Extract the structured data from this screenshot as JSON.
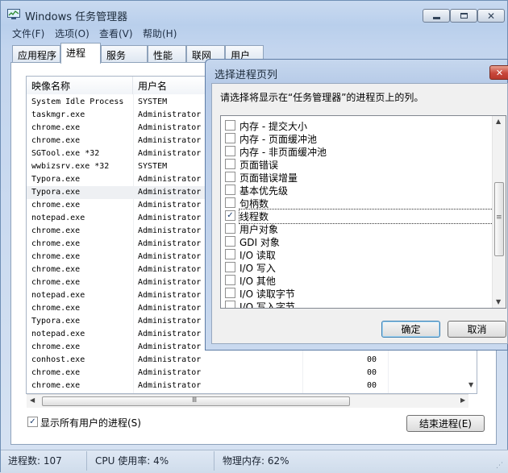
{
  "window": {
    "title": "Windows 任务管理器",
    "menu": [
      "文件(F)",
      "选项(O)",
      "查看(V)",
      "帮助(H)"
    ],
    "tabs": [
      "应用程序",
      "进程",
      "服务",
      "性能",
      "联网",
      "用户"
    ],
    "active_tab": "进程"
  },
  "process_table": {
    "columns": [
      "映像名称",
      "用户名"
    ],
    "rows": [
      {
        "name": "System Idle Process",
        "user": "SYSTEM",
        "value": ""
      },
      {
        "name": "taskmgr.exe",
        "user": "Administrator",
        "value": ""
      },
      {
        "name": "chrome.exe",
        "user": "Administrator",
        "value": ""
      },
      {
        "name": "chrome.exe",
        "user": "Administrator",
        "value": ""
      },
      {
        "name": "SGTool.exe *32",
        "user": "Administrator",
        "value": ""
      },
      {
        "name": "wwbizsrv.exe *32",
        "user": "SYSTEM",
        "value": ""
      },
      {
        "name": "Typora.exe",
        "user": "Administrator",
        "value": ""
      },
      {
        "name": "Typora.exe",
        "user": "Administrator",
        "value": ""
      },
      {
        "name": "chrome.exe",
        "user": "Administrator",
        "value": ""
      },
      {
        "name": "notepad.exe",
        "user": "Administrator",
        "value": ""
      },
      {
        "name": "chrome.exe",
        "user": "Administrator",
        "value": ""
      },
      {
        "name": "chrome.exe",
        "user": "Administrator",
        "value": ""
      },
      {
        "name": "chrome.exe",
        "user": "Administrator",
        "value": ""
      },
      {
        "name": "chrome.exe",
        "user": "Administrator",
        "value": ""
      },
      {
        "name": "chrome.exe",
        "user": "Administrator",
        "value": ""
      },
      {
        "name": "notepad.exe",
        "user": "Administrator",
        "value": ""
      },
      {
        "name": "chrome.exe",
        "user": "Administrator",
        "value": ""
      },
      {
        "name": "Typora.exe",
        "user": "Administrator",
        "value": ""
      },
      {
        "name": "notepad.exe",
        "user": "Administrator",
        "value": ""
      },
      {
        "name": "chrome.exe",
        "user": "Administrator",
        "value": ""
      },
      {
        "name": "conhost.exe",
        "user": "Administrator",
        "value": "00"
      },
      {
        "name": "chrome.exe",
        "user": "Administrator",
        "value": "00"
      },
      {
        "name": "chrome.exe",
        "user": "Administrator",
        "value": "00"
      }
    ],
    "selected_row": 7
  },
  "show_all_users": {
    "label": "显示所有用户的进程(S)",
    "checked": true
  },
  "end_process_label": "结束进程(E)",
  "status": {
    "processes": "进程数: 107",
    "cpu": "CPU 使用率: 4%",
    "memory": "物理内存: 62%"
  },
  "dialog": {
    "title": "选择进程页列",
    "instruction": "请选择将显示在“任务管理器”的进程页上的列。",
    "options": [
      {
        "label": "内存 - 提交大小",
        "checked": false
      },
      {
        "label": "内存 - 页面缓冲池",
        "checked": false
      },
      {
        "label": "内存 - 非页面缓冲池",
        "checked": false
      },
      {
        "label": "页面错误",
        "checked": false
      },
      {
        "label": "页面错误增量",
        "checked": false
      },
      {
        "label": "基本优先级",
        "checked": false
      },
      {
        "label": "句柄数",
        "checked": false
      },
      {
        "label": "线程数",
        "checked": true
      },
      {
        "label": "用户对象",
        "checked": false
      },
      {
        "label": "GDI 对象",
        "checked": false
      },
      {
        "label": "I/O 读取",
        "checked": false
      },
      {
        "label": "I/O 写入",
        "checked": false
      },
      {
        "label": "I/O 其他",
        "checked": false
      },
      {
        "label": "I/O 读取字节",
        "checked": false
      },
      {
        "label": "I/O 写入字节",
        "checked": false
      }
    ],
    "focused_option": 7,
    "ok_label": "确定",
    "cancel_label": "取消"
  },
  "icons": {
    "app": "task-manager-icon",
    "minimize": "minimize-icon",
    "maximize": "maximize-icon",
    "close": "close-icon",
    "checkmark": "check-icon",
    "scroll_up": "arrow-up-icon",
    "scroll_down": "arrow-down-icon",
    "scroll_left": "arrow-left-icon",
    "scroll_right": "arrow-right-icon",
    "thumb_grip": "grip-icon"
  },
  "colors": {
    "title_bar": "#c3d5ee",
    "close_red": "#c8473b",
    "selection": "#eef0f3"
  }
}
